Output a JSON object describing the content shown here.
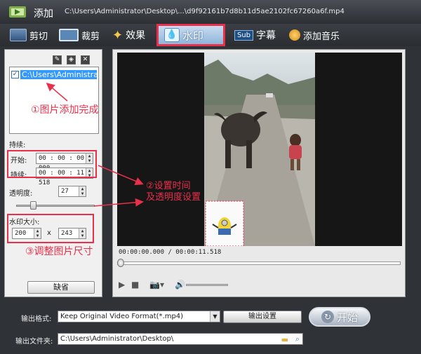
{
  "window": {
    "title": "添加",
    "file_path": "C:\\Users\\Administrator\\Desktop\\...\\d9f92161b7d8b11d5ae2102fc67260a6f.mp4"
  },
  "tabs": [
    {
      "label": "剪切",
      "icon": "film-icon"
    },
    {
      "label": "裁剪",
      "icon": "crop-icon"
    },
    {
      "label": "效果",
      "icon": "star-icon"
    },
    {
      "label": "水印",
      "icon": "droplet-icon",
      "active": true
    },
    {
      "label": "字幕",
      "icon": "subtitle-icon"
    },
    {
      "label": "添加音乐",
      "icon": "music-icon"
    }
  ],
  "watermark": {
    "list_item": "C:\\Users\\Administrator\\Desktop\\...",
    "duration_label": "持续:",
    "start_label": "开始:",
    "start_value": "00 : 00 : 00 . 000",
    "length_label": "持续:",
    "length_value": "00 : 00 : 11 . 518",
    "opacity_label": "透明度:",
    "opacity_value": "27",
    "opacity_level": 27,
    "size_label": "水印大小:",
    "width": "200",
    "times": "x",
    "height": "243",
    "default_button": "缺省"
  },
  "player": {
    "timecode": "00:00:00.000 / 00:00:11.518",
    "seek_progress": 0
  },
  "output": {
    "format_label": "输出格式:",
    "format_value": "Keep Original Video Format(*.mp4)",
    "settings_button": "输出设置",
    "start_button": "开始",
    "folder_label": "输出文件夹:",
    "folder_value": "C:\\Users\\Administrator\\Desktop\\"
  },
  "annotations": {
    "a1": "①图片添加完成",
    "a2_line1": "②设置时间",
    "a2_line2": "及透明度设置",
    "a3": "③调整图片尺寸"
  },
  "colors": {
    "annotation": "#e8304a",
    "selection": "#3399ff"
  }
}
